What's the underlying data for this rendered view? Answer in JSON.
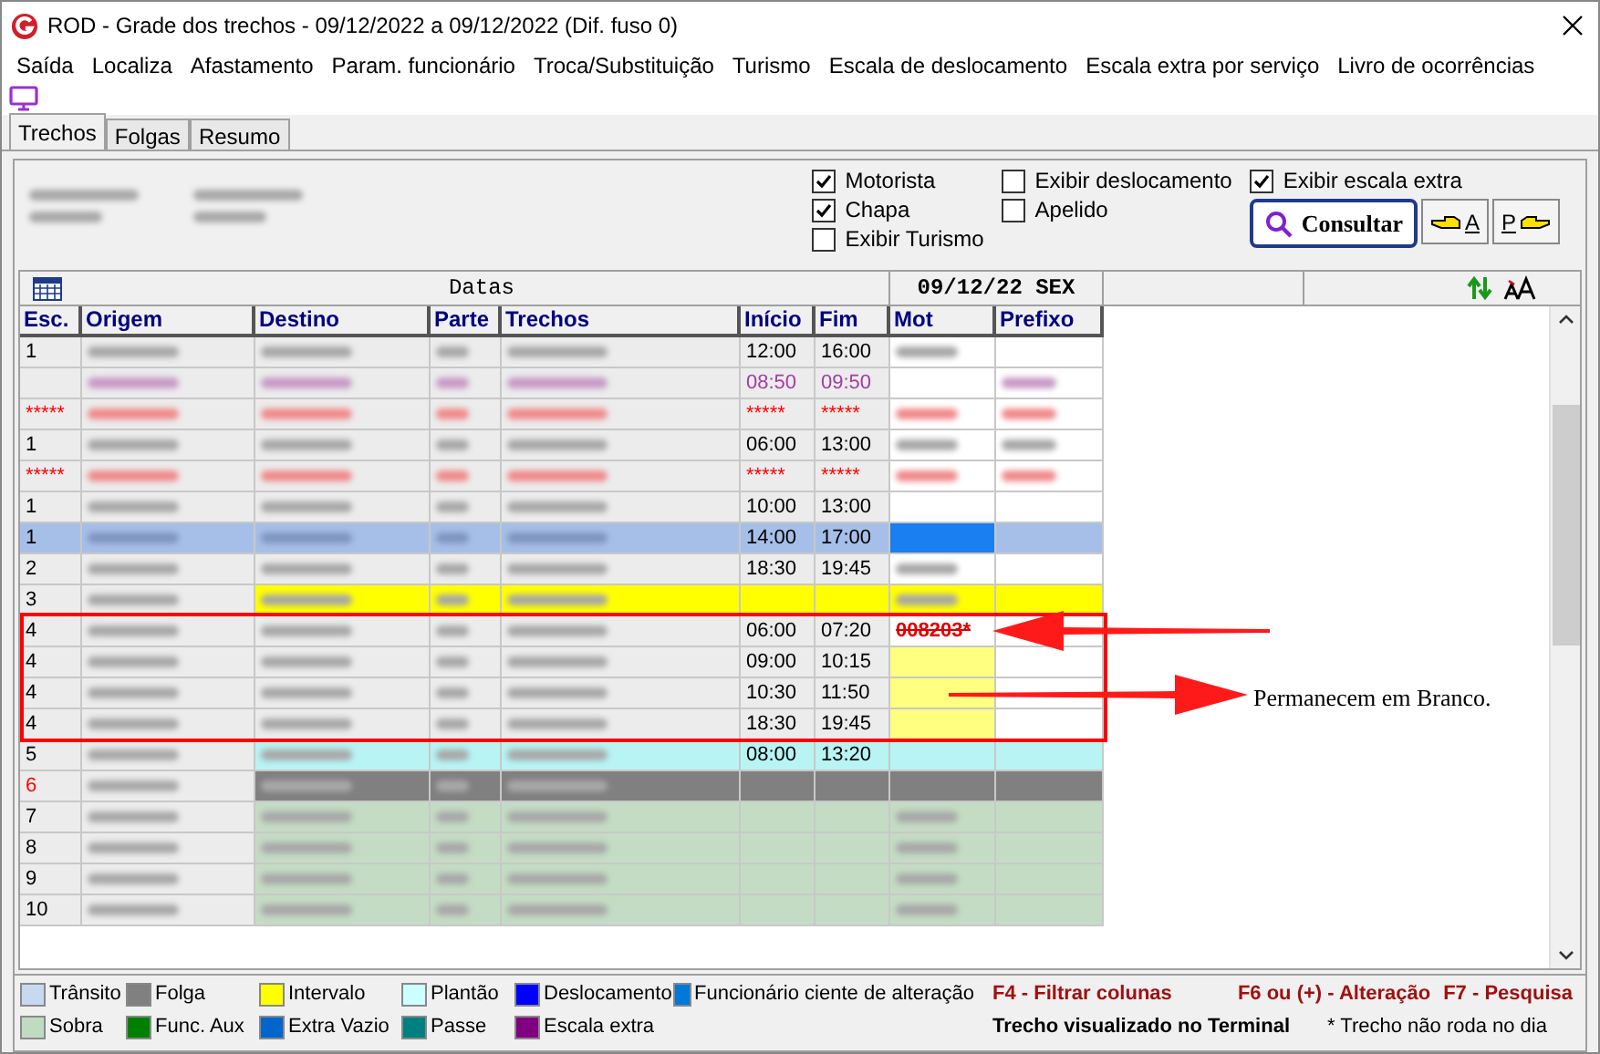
{
  "window": {
    "title": "ROD - Grade dos trechos  -  09/12/2022 a 09/12/2022 (Dif. fuso 0)"
  },
  "menu": [
    "Saída",
    "Localiza",
    "Afastamento",
    "Param. funcionário",
    "Troca/Substituição",
    "Turismo",
    "Escala de deslocamento",
    "Escala extra por serviço",
    "Livro de ocorrências"
  ],
  "tabs": [
    {
      "label": "Trechos",
      "selected": true
    },
    {
      "label": "Folgas",
      "selected": false
    },
    {
      "label": "Resumo",
      "selected": false
    }
  ],
  "options": [
    {
      "label": "Motorista",
      "checked": true
    },
    {
      "label": "Exibir deslocamento",
      "checked": false
    },
    {
      "label": "Exibir escala extra",
      "checked": true
    },
    {
      "label": "Chapa",
      "checked": true
    },
    {
      "label": "Apelido",
      "checked": false
    },
    {
      "label": "Exibir Turismo",
      "checked": false
    }
  ],
  "buttons": {
    "consult": "Consultar",
    "prev": "A",
    "next": "P"
  },
  "grid": {
    "dates_label": "Datas",
    "date": "09/12/22 SEX",
    "columns": [
      "Esc.",
      "Origem",
      "Destino",
      "Parte",
      "Trechos",
      "Início",
      "Fim",
      "Mot",
      "Prefixo"
    ],
    "rows": [
      {
        "kind": "normal",
        "esc": "1",
        "start": "12:00",
        "end": "16:00",
        "mot": {
          "kind": "redacted"
        },
        "highlighted": false
      },
      {
        "kind": "extra",
        "esc": "",
        "start": "08:50",
        "end": "09:50",
        "mot": {
          "kind": "empty"
        },
        "highlighted": false
      },
      {
        "kind": "invalid",
        "esc": "*****",
        "start": "*****",
        "end": "*****",
        "mot": {
          "kind": "redacted"
        },
        "highlighted": false
      },
      {
        "kind": "normal",
        "esc": "1",
        "start": "06:00",
        "end": "13:00",
        "mot": {
          "kind": "redacted"
        },
        "highlighted": false
      },
      {
        "kind": "invalid",
        "esc": "*****",
        "start": "*****",
        "end": "*****",
        "mot": {
          "kind": "redacted"
        },
        "highlighted": false
      },
      {
        "kind": "normal",
        "esc": "1",
        "start": "10:00",
        "end": "13:00",
        "mot": {
          "kind": "empty"
        },
        "highlighted": false
      },
      {
        "kind": "selected",
        "esc": "1",
        "start": "14:00",
        "end": "17:00",
        "mot": {
          "kind": "aware"
        },
        "highlighted": false
      },
      {
        "kind": "normal",
        "esc": "2",
        "start": "18:30",
        "end": "19:45",
        "mot": {
          "kind": "redacted"
        },
        "highlighted": false
      },
      {
        "kind": "interval",
        "esc": "3",
        "start": "",
        "end": "",
        "mot": {
          "kind": "redacted"
        },
        "highlighted": false
      },
      {
        "kind": "normal",
        "esc": "4",
        "start": "06:00",
        "end": "07:20",
        "mot": {
          "kind": "text",
          "text": "008203*"
        },
        "highlighted": true
      },
      {
        "kind": "normal",
        "esc": "4",
        "start": "09:00",
        "end": "10:15",
        "mot": {
          "kind": "pending"
        },
        "highlighted": true
      },
      {
        "kind": "normal",
        "esc": "4",
        "start": "10:30",
        "end": "11:50",
        "mot": {
          "kind": "pending"
        },
        "highlighted": true
      },
      {
        "kind": "normal",
        "esc": "4",
        "start": "18:30",
        "end": "19:45",
        "mot": {
          "kind": "pending"
        },
        "highlighted": true
      },
      {
        "kind": "duty",
        "esc": "5",
        "start": "08:00",
        "end": "13:20",
        "mot": {
          "kind": "empty"
        },
        "highlighted": false
      },
      {
        "kind": "dayoff",
        "esc": "6",
        "start": "",
        "end": "",
        "mot": {
          "kind": "empty"
        },
        "highlighted": false
      },
      {
        "kind": "spare",
        "esc": "7",
        "start": "",
        "end": "",
        "mot": {
          "kind": "redacted"
        },
        "highlighted": false
      },
      {
        "kind": "spare",
        "esc": "8",
        "start": "",
        "end": "",
        "mot": {
          "kind": "redacted"
        },
        "highlighted": false
      },
      {
        "kind": "spare",
        "esc": "9",
        "start": "",
        "end": "",
        "mot": {
          "kind": "redacted"
        },
        "highlighted": false
      },
      {
        "kind": "spare",
        "esc": "10",
        "start": "",
        "end": "",
        "mot": {
          "kind": "redacted"
        },
        "highlighted": false
      }
    ]
  },
  "annotation": {
    "text": "Permanecem em Branco."
  },
  "legend": [
    [
      {
        "label": "Trânsito",
        "color": "#c6d9f0"
      },
      {
        "label": "Folga",
        "color": "#808080"
      },
      {
        "label": "Intervalo",
        "color": "#ffff00"
      },
      {
        "label": "Plantão",
        "color": "#ccffff"
      },
      {
        "label": "Deslocamento",
        "color": "#0000ff"
      },
      {
        "label": "Funcionário ciente de alteração",
        "color": "#0078d7"
      }
    ],
    [
      {
        "label": "Sobra",
        "color": "#c0dcc0"
      },
      {
        "label": "Func. Aux",
        "color": "#008000"
      },
      {
        "label": "Extra Vazio",
        "color": "#0066cc"
      },
      {
        "label": "Passe",
        "color": "#008080"
      },
      {
        "label": "Escala extra",
        "color": "#800080"
      }
    ]
  ],
  "shortcuts": {
    "filter": "F4 - Filtrar colunas",
    "edit": "F6 ou (+) - Alteração",
    "search": "F7 - Pesquisa",
    "terminal": "Trecho visualizado no Terminal",
    "not_running": "* Trecho não roda no dia"
  }
}
